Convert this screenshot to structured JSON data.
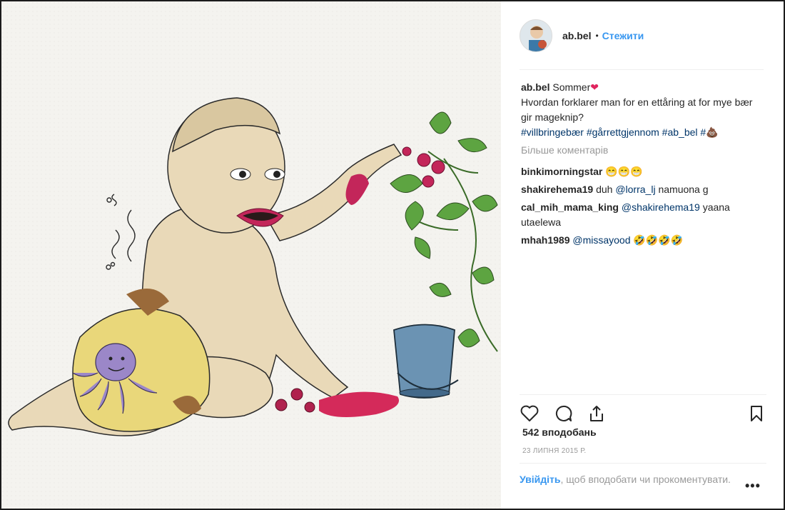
{
  "post": {
    "username": "ab.bel",
    "follow_label": "Стежити",
    "caption_user": "ab.bel",
    "caption_lead": "Sommer",
    "caption_heart": "❤",
    "caption_line2": "Hvordan forklarer man for en ettåring at for mye bær gir mageknip?",
    "hashtags": [
      "#villbringebær",
      "#gårrettgjennom",
      "#ab_bel",
      "#"
    ],
    "caption_trailing_emoji": "💩",
    "more_comments": "Більше коментарів",
    "comments": [
      {
        "user": "binkimorningstar",
        "mention": "",
        "text": "😁😁😁"
      },
      {
        "user": "shakirehema19",
        "pre": "duh",
        "mention": "@lorra_lj",
        "text": "namuona g"
      },
      {
        "user": "cal_mih_mama_king",
        "mention": "@shakirehema19",
        "text": "yaana utaelewa"
      },
      {
        "user": "mhah1989",
        "mention": "@missayood",
        "text": "🤣🤣🤣🤣"
      }
    ],
    "likes": "542 вподобань",
    "date": "23 ЛИПНЯ 2015 Р.",
    "login_link": "Увійдіть",
    "login_rest": ", щоб вподобати чи прокоментувати.",
    "more_options": "•••"
  },
  "icons": [
    "heart-icon",
    "comment-icon",
    "share-icon",
    "bookmark-icon"
  ],
  "colors": {
    "link": "#3897f0",
    "hashtag": "#003569",
    "muted": "#999999",
    "text": "#262626"
  }
}
